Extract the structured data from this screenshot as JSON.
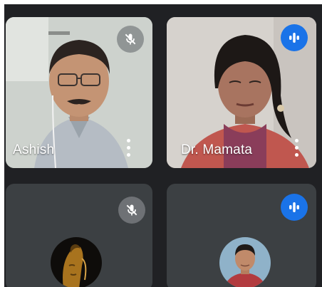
{
  "participants": [
    {
      "name": "Ashish",
      "mic": "muted",
      "mic_icon": "mic-off-icon",
      "menu_icon": "more-vert-icon"
    },
    {
      "name": "Dr. Mamata",
      "mic": "speaking",
      "mic_icon": "audio-level-icon",
      "menu_icon": "more-vert-icon"
    },
    {
      "name": "",
      "mic": "muted",
      "mic_icon": "mic-off-icon",
      "avatar": "buddha-avatar"
    },
    {
      "name": "",
      "mic": "speaking",
      "mic_icon": "audio-level-icon",
      "avatar": "profile-avatar"
    }
  ],
  "colors": {
    "background": "#202124",
    "tile": "#3c4043",
    "speaking_accent": "#1a73e8",
    "muted_badge": "#5f6368"
  }
}
